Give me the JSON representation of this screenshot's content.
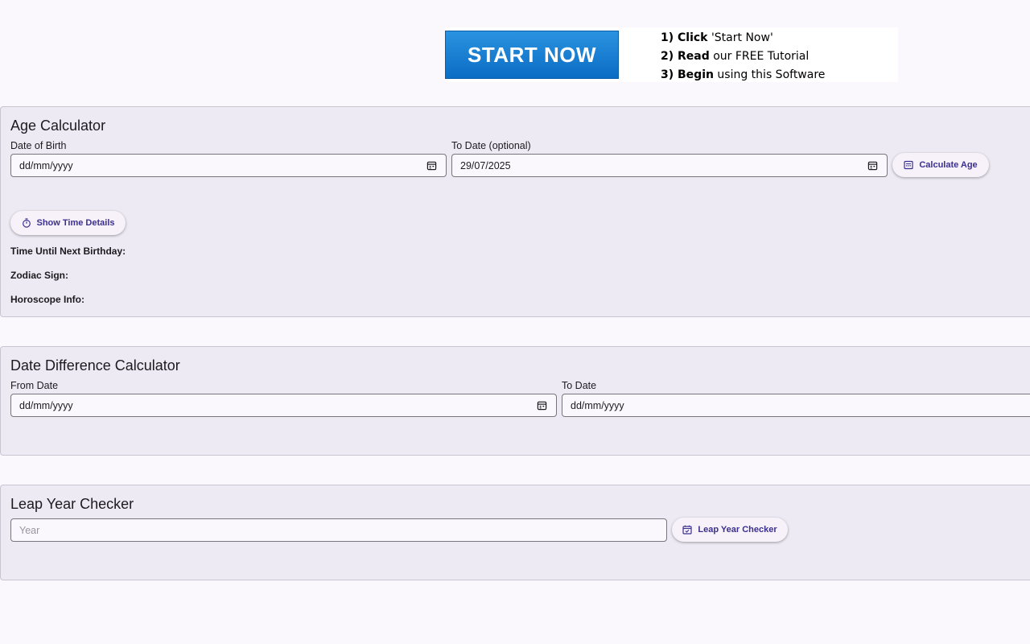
{
  "ad": {
    "button_label": "START NOW",
    "steps": [
      {
        "bold": "1) Click",
        "rest": " 'Start Now'"
      },
      {
        "bold": "2) Read",
        "rest": " our FREE Tutorial"
      },
      {
        "bold": "3) Begin",
        "rest": "  using  this Software"
      }
    ]
  },
  "age_calculator": {
    "title": "Age Calculator",
    "dob_label": "Date of Birth",
    "dob_value": "dd/mm/yyyy",
    "to_date_label": "To Date (optional)",
    "to_date_value": "29/07/2025",
    "calculate_label": "Calculate Age",
    "show_time_label": "Show Time Details",
    "next_birthday_label": "Time Until Next Birthday:",
    "zodiac_label": "Zodiac Sign:",
    "horoscope_label": "Horoscope Info:"
  },
  "date_difference": {
    "title": "Date Difference Calculator",
    "from_label": "From Date",
    "from_value": "dd/mm/yyyy",
    "to_label": "To Date",
    "to_value": "dd/mm/yyyy"
  },
  "leap_year": {
    "title": "Leap Year Checker",
    "year_placeholder": "Year",
    "button_label": "Leap Year Checker"
  },
  "colors": {
    "background": "#fbf8fd",
    "card": "#eeeaf4",
    "accent_text": "#3b2f8f",
    "ad_blue": "#0b6cc4"
  },
  "icons": {
    "calendar": "calendar-icon",
    "stopwatch": "stopwatch-icon",
    "calculator": "calculator-icon",
    "calendar_check": "calendar-check-icon"
  }
}
